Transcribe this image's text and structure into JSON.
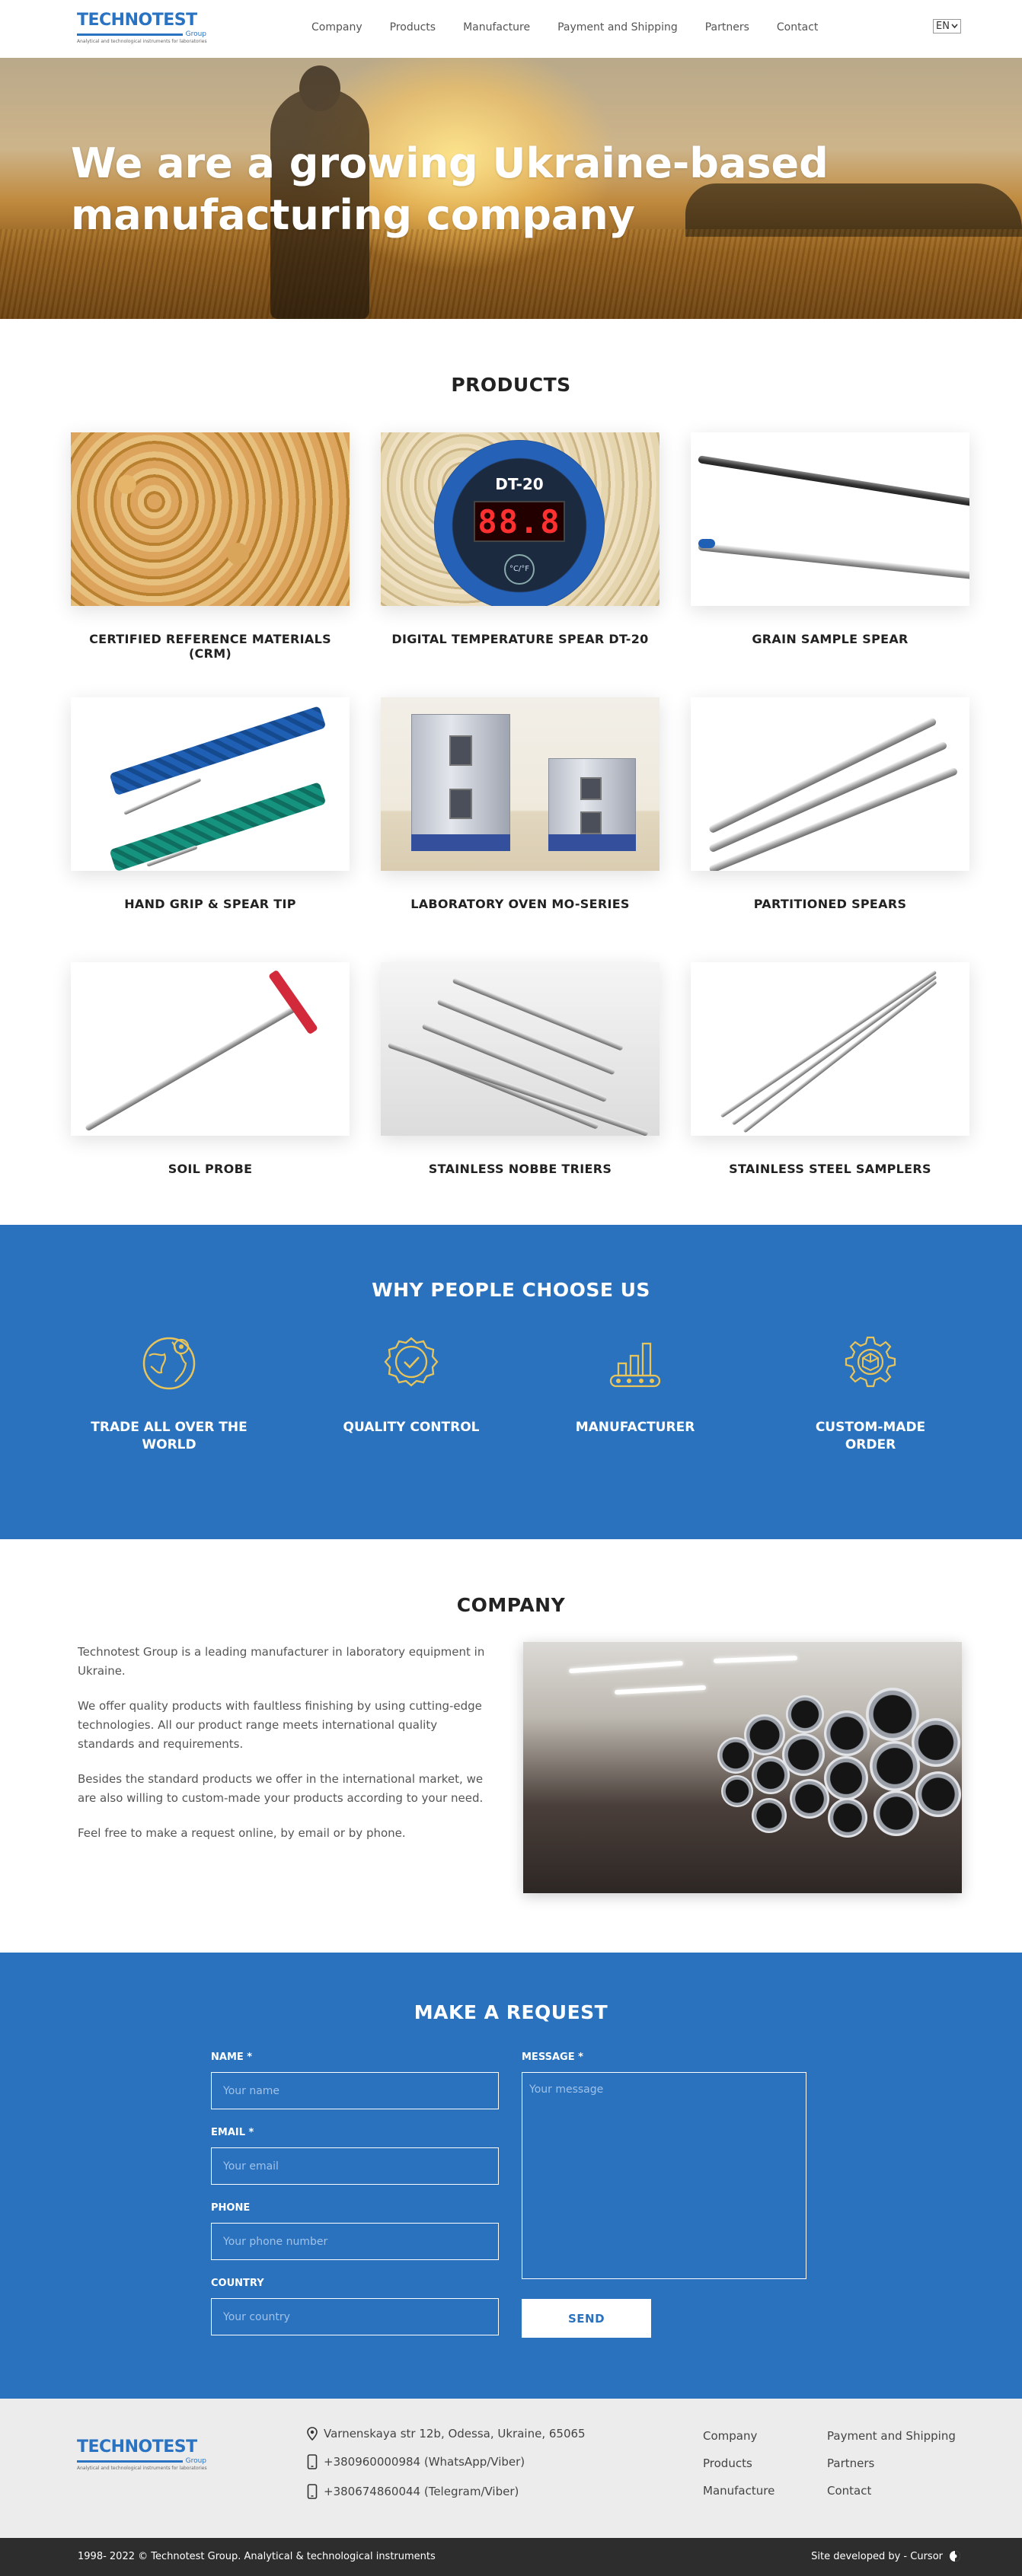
{
  "header": {
    "logo_word": "TECHNOTEST",
    "logo_group": "Group",
    "logo_tagline": "Analytical and technological instruments for laboratories",
    "nav": [
      "Company",
      "Products",
      "Manufacture",
      "Payment and Shipping",
      "Partners",
      "Contact"
    ],
    "language": "EN"
  },
  "hero": {
    "title_line1": "We are a growing Ukraine-based",
    "title_line2": "manufacturing company",
    "slides": 3,
    "active_slide": 1
  },
  "products": {
    "title": "PRODUCTS",
    "items": [
      "CERTIFIED REFERENCE MATERIALS (CRM)",
      "DIGITAL TEMPERATURE SPEAR DT-20",
      "GRAIN SAMPLE SPEAR",
      "HAND GRIP & SPEAR TIP",
      "LABORATORY OVEN MO-SERIES",
      "PARTITIONED SPEARS",
      "SOIL PROBE",
      "STAINLESS NOBBE TRIERS",
      "STAINLESS STEEL SAMPLERS"
    ],
    "dt20_display": {
      "model": "DT-20",
      "digits": "88.8",
      "unit": "°C/°F"
    }
  },
  "why": {
    "title": "WHY PEOPLE CHOOSE US",
    "items": [
      {
        "label_line1": "TRADE ALL OVER THE",
        "label_line2": "WORLD",
        "icon": "globe-icon"
      },
      {
        "label_line1": "QUALITY CONTROL",
        "label_line2": "",
        "icon": "quality-badge-icon"
      },
      {
        "label_line1": "MANUFACTURER",
        "label_line2": "",
        "icon": "factory-icon"
      },
      {
        "label_line1": "CUSTOM-MADE",
        "label_line2": "ORDER",
        "icon": "custom-gear-icon"
      }
    ],
    "icon_color": "#e8c45a"
  },
  "company": {
    "title": "COMPANY",
    "paragraphs": [
      "Technotest Group is a leading manufacturer in laboratory equipment in Ukraine.",
      "We offer quality products with faultless finishing by using cutting-edge technologies. All our product range meets international quality standards and requirements.",
      "Besides the standard products we offer in the international market, we are also willing to custom-made your products according to your need.",
      "Feel free to make a request online, by email or by phone."
    ]
  },
  "request": {
    "title": "MAKE A REQUEST",
    "name_label": "NAME *",
    "name_placeholder": "Your name",
    "email_label": "EMAIL *",
    "email_placeholder": "Your email",
    "phone_label": "PHONE",
    "phone_placeholder": "Your phone number",
    "country_label": "COUNTRY",
    "country_placeholder": "Your country",
    "message_label": "MESSAGE *",
    "message_placeholder": "Your message",
    "send_label": "SEND"
  },
  "footer": {
    "address": "Varnenskaya str 12b, Odessa, Ukraine, 65065",
    "phone1": "+380960000984 (WhatsApp/Viber)",
    "phone2": "+380674860044 (Telegram/Viber)",
    "nav_col1": [
      "Company",
      "Products",
      "Manufacture"
    ],
    "nav_col2": [
      "Payment and Shipping",
      "Partners",
      "Contact"
    ],
    "copyright": "1998- 2022 © Technotest Group. Analytical & technological instruments",
    "developer": "Site developed by - Cursor"
  },
  "colors": {
    "brand_blue": "#2a72be",
    "accent_gold": "#e8c45a",
    "footer_bg": "#ececec",
    "bottom_bar": "#2d2d2d"
  }
}
